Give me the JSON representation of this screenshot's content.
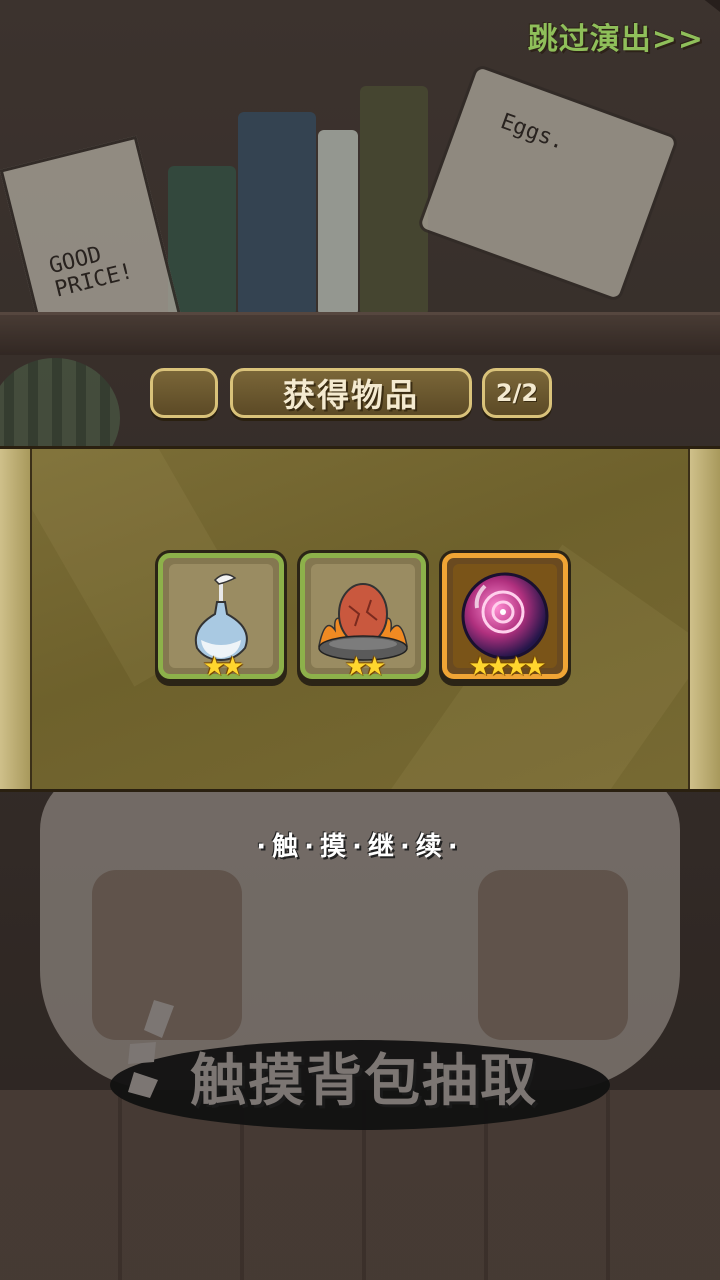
{
  "header": {
    "skip_label": "跳过演出>>"
  },
  "reward_panel": {
    "title": "获得物品",
    "count": "2/2",
    "items": [
      {
        "name": "vase-item-icon",
        "stars": 2,
        "stars_text": "★★",
        "frame_color": "#8db14a"
      },
      {
        "name": "fire-egg-item-icon",
        "stars": 2,
        "stars_text": "★★",
        "frame_color": "#8db14a"
      },
      {
        "name": "magic-orb-item-icon",
        "stars": 4,
        "stars_text": "★★★★",
        "frame_color": "#f0a535"
      }
    ]
  },
  "touch_continue": "·触·摸·继·续·",
  "bottom_hint": "触摸背包抽取",
  "background": {
    "poster_left_text": "GOOD PRICE!",
    "poster_right_text": "Eggs."
  }
}
